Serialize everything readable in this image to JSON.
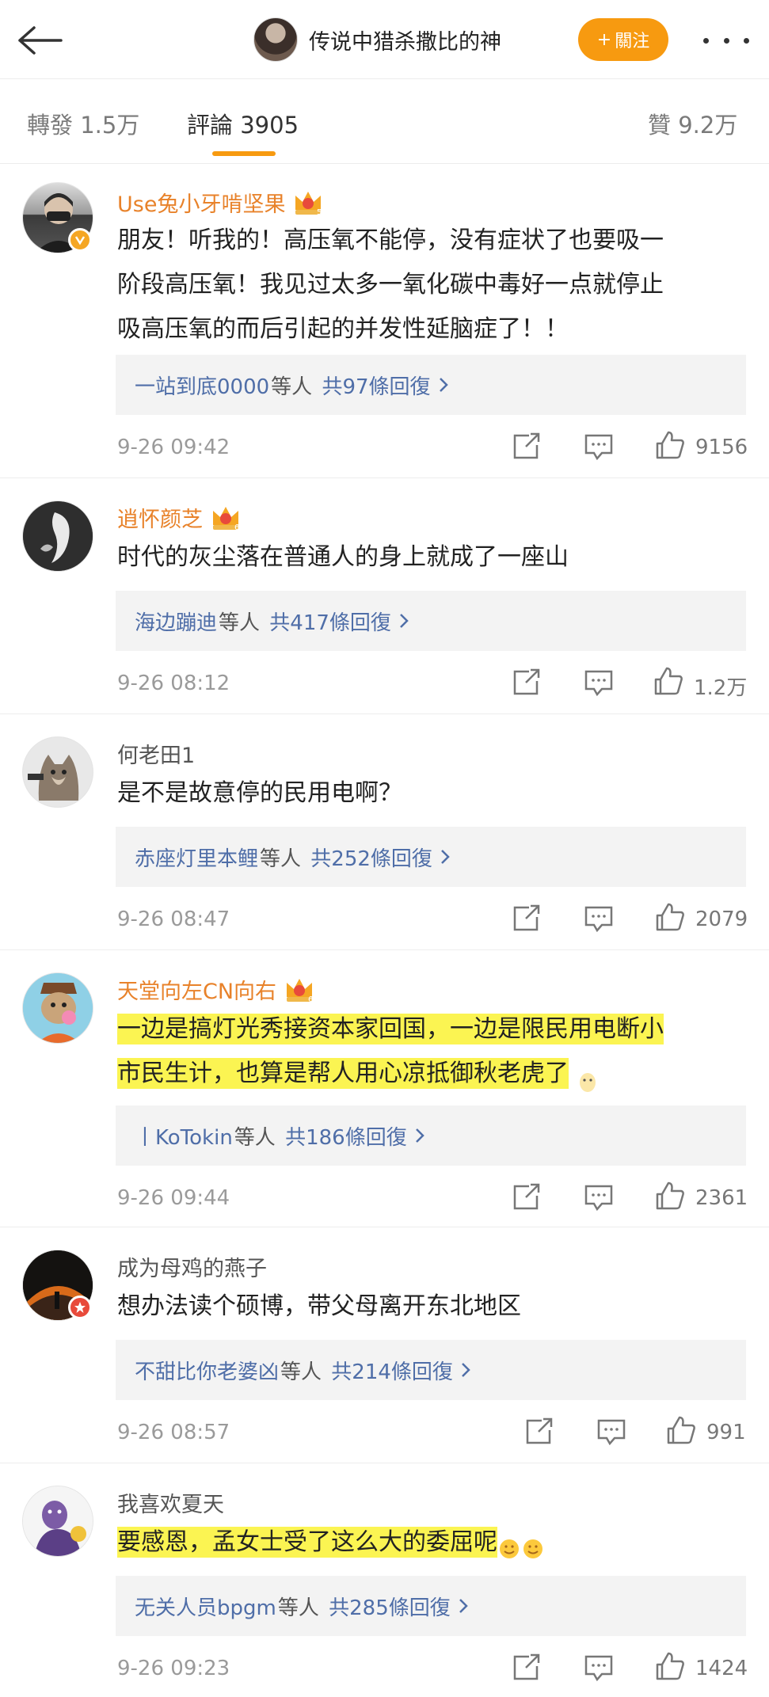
{
  "header": {
    "title": "传说中猎杀撒比的神",
    "follow_label": "關注",
    "follow_plus": "+"
  },
  "tabs": {
    "repost": "轉發 1.5万",
    "comments": "評論 3905",
    "likes": "贊 9.2万"
  },
  "colors": {
    "accent": "#f79a10",
    "link": "#4f6ea8",
    "highlight": "#fbf452"
  },
  "comments": [
    {
      "user": "Use兔小牙啃坚果",
      "vip_level": "5",
      "text_lines": [
        "朋友！听我的！高压氧不能停，没有症状了也要吸一",
        "阶段高压氧！我见过太多一氧化碳中毒好一点就停止",
        "吸高压氧的而后引起的并发性延脑症了！！"
      ],
      "reply_names": "一站到底0000",
      "reply_mid": "等人",
      "reply_count": "共97條回復",
      "time": "9-26 09:42",
      "likes": "9156"
    },
    {
      "user": "逍怀颜芝",
      "vip_level": "6",
      "text_lines": [
        "时代的灰尘落在普通人的身上就成了一座山"
      ],
      "reply_names": "海边蹦迪",
      "reply_mid": "等人",
      "reply_count": "共417條回復",
      "time": "9-26 08:12",
      "likes": "1.2万"
    },
    {
      "user": "何老田1",
      "text_lines": [
        "是不是故意停的民用电啊？"
      ],
      "reply_names": "赤座灯里本鲤",
      "reply_mid": "等人",
      "reply_count": "共252條回復",
      "time": "9-26 08:47",
      "likes": "2079"
    },
    {
      "user": "天堂向左CN向右",
      "vip_level": "6",
      "text_lines": [
        "一边是搞灯光秀接资本家回国，一边是限民用电断小",
        "市民生计，也算是帮人用心凉抵御秋老虎了"
      ],
      "reply_names": "丨KoTokin",
      "reply_mid": "等人",
      "reply_count": "共186條回復",
      "time": "9-26 09:44",
      "likes": "2361"
    },
    {
      "user": "成为母鸡的燕子",
      "text_lines": [
        "想办法读个硕博，带父母离开东北地区"
      ],
      "reply_names": "不甜比你老婆凶",
      "reply_mid": "等人",
      "reply_count": "共214條回復",
      "time": "9-26 08:57",
      "likes": "991"
    },
    {
      "user": "我喜欢夏天",
      "text_lines": [
        "要感恩，孟女士受了这么大的委屈呢"
      ],
      "reply_names": "无关人员bpgm",
      "reply_mid": "等人",
      "reply_count": "共285條回復",
      "time": "9-26 09:23",
      "likes": "1424"
    }
  ],
  "icons": [
    "back-arrow-icon",
    "more-icon",
    "share-icon",
    "comment-icon",
    "like-icon",
    "crown-icon",
    "verified-icon",
    "chevron-right-icon",
    "emoji-icon"
  ]
}
